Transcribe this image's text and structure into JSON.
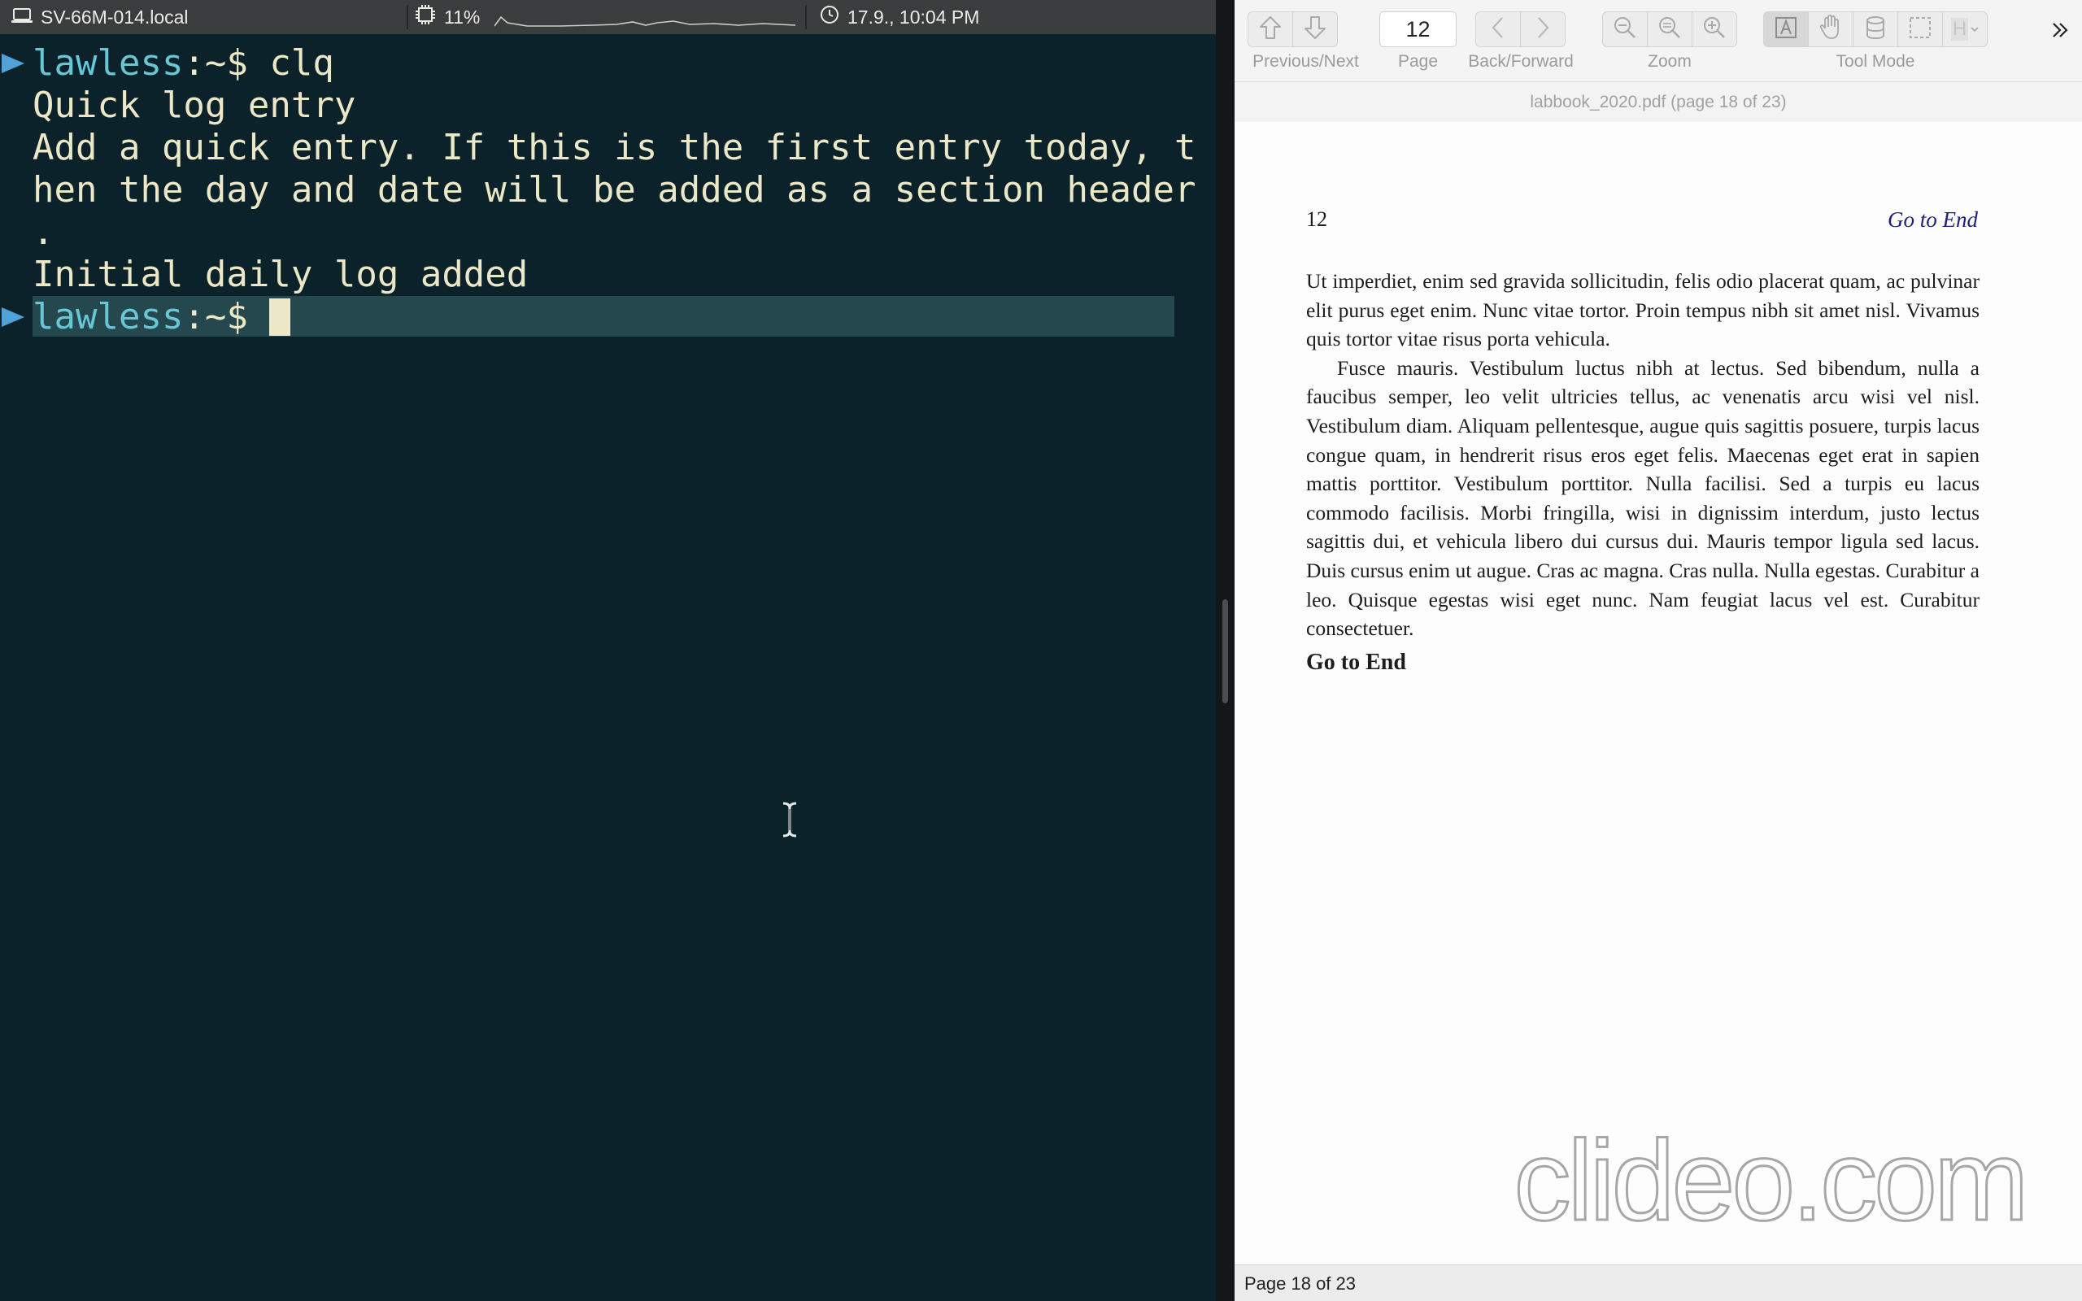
{
  "terminal": {
    "status": {
      "hostname": "SV-66M-014.local",
      "cpu": "11%",
      "datetime": "17.9., 10:04 PM"
    },
    "prompt": {
      "user": "lawless",
      "path": ":~$"
    },
    "command": "clq",
    "output": [
      "Quick log entry",
      "Add a quick entry. If this is the first entry today, t",
      "hen the day and date will be added as a section header",
      ".",
      "Initial daily log added"
    ],
    "colors": {
      "background": "#0c222a",
      "prompt": "#67c7d6",
      "text": "#ece8c7",
      "active_line": "#24484d"
    }
  },
  "viewer": {
    "toolbar": {
      "prev_next_label": "Previous/Next",
      "page_label": "Page",
      "page_value": "12",
      "back_forward_label": "Back/Forward",
      "zoom_label": "Zoom",
      "tool_mode_label": "Tool Mode",
      "highlight_glyph": "H"
    },
    "doc_title": "labbook_2020.pdf (page 18 of 23)",
    "page": {
      "number": "12",
      "running_link": "Go to End",
      "paragraphs": [
        "Ut imperdiet, enim sed gravida sollicitudin, felis odio placerat quam, ac pulvinar elit purus eget enim. Nunc vitae tortor. Proin tempus nibh sit amet nisl. Vivamus quis tortor vitae risus porta vehicula.",
        "Fusce mauris. Vestibulum luctus nibh at lectus. Sed bibendum, nulla a faucibus semper, leo velit ultricies tellus, ac venenatis arcu wisi vel nisl. Vestibulum diam. Aliquam pellentesque, augue quis sagittis posuere, turpis lacus congue quam, in hendrerit risus eros eget felis. Maecenas eget erat in sapien mattis porttitor. Vestibulum porttitor. Nulla facilisi. Sed a turpis eu lacus commodo facilisis. Morbi fringilla, wisi in dignissim interdum, justo lectus sagittis dui, et vehicula libero dui cursus dui. Mauris tempor ligula sed lacus. Duis cursus enim ut augue. Cras ac magna. Cras nulla. Nulla egestas. Curabitur a leo. Quisque egestas wisi eget nunc. Nam feugiat lacus vel est. Curabitur consectetuer."
      ],
      "heading": "Go to End"
    },
    "watermark": "clideo.com",
    "statusbar": "Page 18 of 23"
  }
}
